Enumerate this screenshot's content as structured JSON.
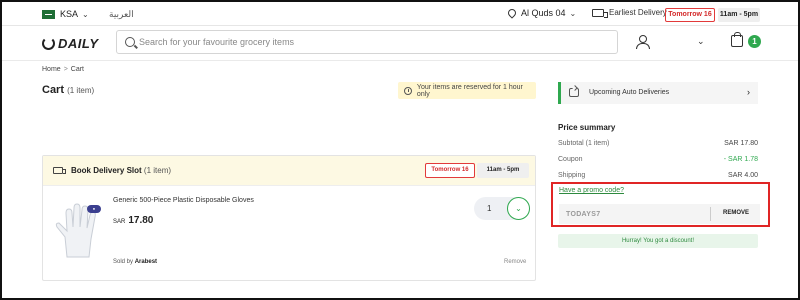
{
  "topbar": {
    "country": "KSA",
    "language": "العربية",
    "location": "Al Quds 04",
    "delivery_label": "Earliest Delivery",
    "delivery_day": "Tomorrow 16",
    "delivery_time": "11am - 5pm"
  },
  "header": {
    "logo_text": "DAILY",
    "search_placeholder": "Search for your favourite grocery items",
    "cart_count": "1"
  },
  "breadcrumb": {
    "home": "Home",
    "separator": ">",
    "current": "Cart"
  },
  "cart": {
    "title": "Cart",
    "count": "(1 item)",
    "reserved_note": "Your items are reserved for 1 hour only"
  },
  "slot": {
    "title": "Book Delivery Slot",
    "count": "(1 item)",
    "day": "Tomorrow 16",
    "time": "11am - 5pm"
  },
  "product": {
    "name": "Generic 500-Piece Plastic Disposable Gloves",
    "currency": "SAR",
    "price": "17.80",
    "quantity": "1",
    "seller_label": "Sold by",
    "seller": "Arabest",
    "remove": "Remove"
  },
  "sidebar": {
    "auto_deliveries": "Upcoming Auto Deliveries",
    "summary_title": "Price summary",
    "rows": [
      {
        "label": "Subtotal (1 item)",
        "value": "SAR 17.80"
      },
      {
        "label": "Coupon",
        "value": "- SAR 1.78"
      },
      {
        "label": "Shipping",
        "value": "SAR 4.00"
      }
    ],
    "promo_link": "Have a promo code?",
    "promo_value": "TODAYS7",
    "promo_remove": "REMOVE",
    "discount_message": "Hurray! You got a discount!"
  },
  "colors": {
    "accent_green": "#2fa84f",
    "alert_red": "#e02525"
  }
}
